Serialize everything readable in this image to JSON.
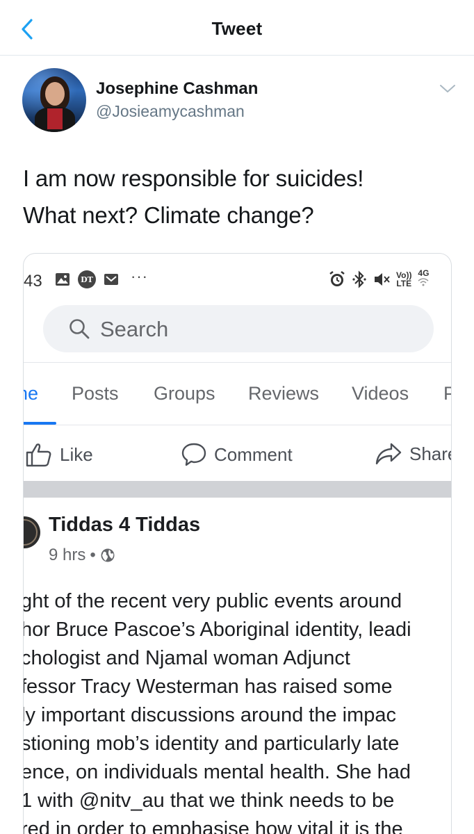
{
  "nav": {
    "title": "Tweet",
    "back_icon": "chevron-left-icon",
    "accent_color": "#1da1f2"
  },
  "tweet": {
    "author_name": "Josephine Cashman",
    "author_handle": "@Josieamycashman",
    "text_lines": [
      "I am now responsible for suicides!",
      "What next? Climate change?"
    ],
    "caret_icon": "chevron-down-icon"
  },
  "embedded_screenshot": {
    "status_bar": {
      "time": "43",
      "left_icons": [
        "image-icon",
        "dt-icon",
        "mail-icon",
        "more-dots-icon"
      ],
      "dt_label": "DT",
      "dots": "···",
      "right_icons": [
        "alarm-icon",
        "bluetooth-icon",
        "mute-icon",
        "volte-icon",
        "4g-signal-icon"
      ],
      "volte_label_top": "Vo))",
      "volte_label_bottom": "LTE",
      "network_label": "4G"
    },
    "search": {
      "placeholder": "Search"
    },
    "tabs": [
      {
        "label": "ne",
        "active": true
      },
      {
        "label": "Posts",
        "active": false
      },
      {
        "label": "Groups",
        "active": false
      },
      {
        "label": "Reviews",
        "active": false
      },
      {
        "label": "Videos",
        "active": false
      },
      {
        "label": "P",
        "active": false
      }
    ],
    "actions": {
      "like": "Like",
      "comment": "Comment",
      "share": "Share"
    },
    "post": {
      "page_name": "Tiddas 4 Tiddas",
      "time": "9 hrs",
      "separator": "•",
      "privacy_icon": "globe-icon",
      "body_lines": [
        "ght of the recent very public events around",
        "hor Bruce Pascoe’s Aboriginal identity, leadi",
        "chologist and Njamal woman Adjunct",
        "fessor Tracy Westerman has raised some",
        "ly important discussions around the impac",
        "stioning mob’s identity and particularly late",
        "ence, on individuals mental health. She had",
        "1 with @nitv_au that we think needs to be",
        "red in order to emphasise how vital it is the"
      ]
    },
    "colors": {
      "facebook_blue": "#1877f2",
      "muted_text": "#65676b",
      "search_bg": "#f0f2f5"
    }
  }
}
